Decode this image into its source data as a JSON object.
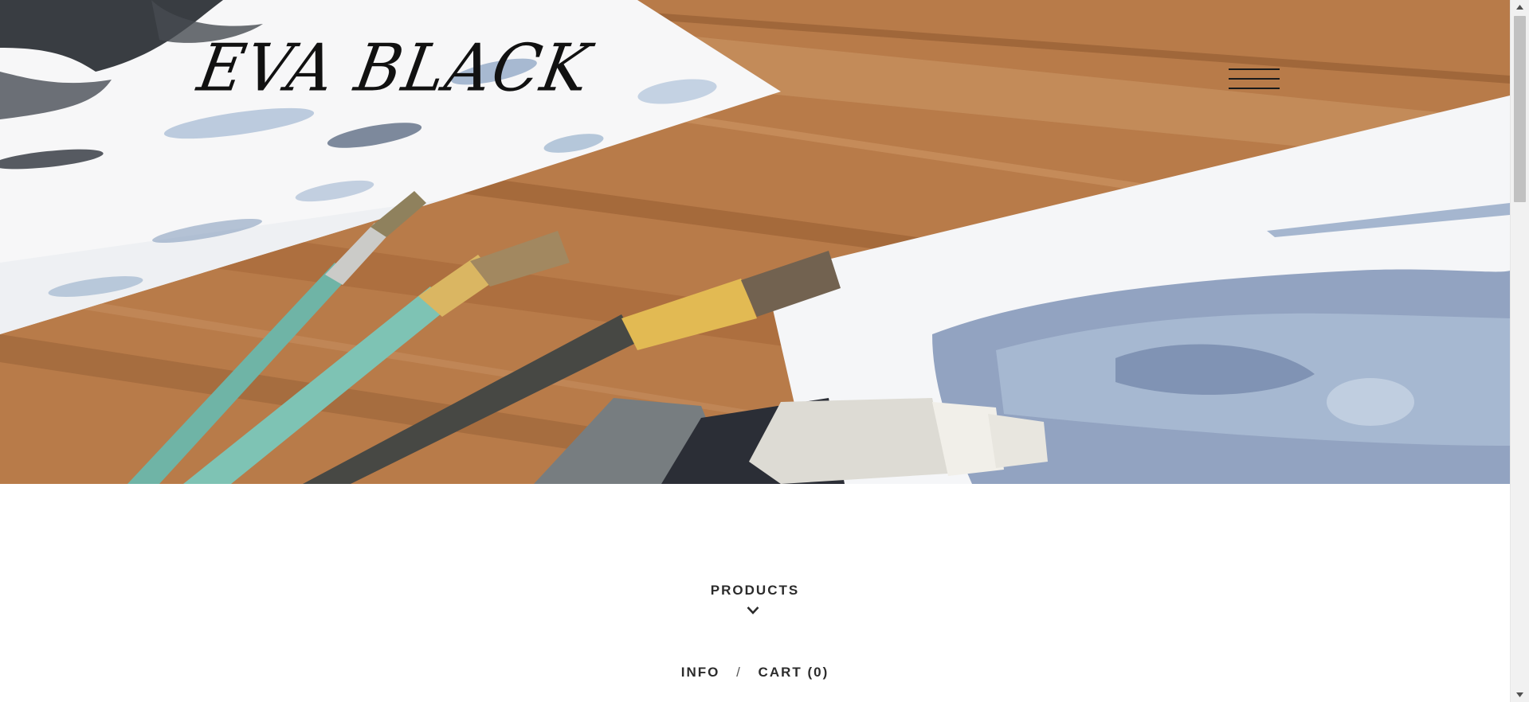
{
  "site": {
    "logo_text": "EVA BLACK"
  },
  "header": {
    "menu_icon": "hamburger-menu-icon"
  },
  "main": {
    "products_label": "PRODUCTS",
    "products_icon": "chevron-down-icon",
    "links": {
      "info_label": "INFO",
      "separator": "/",
      "cart_label": "CART (0)"
    }
  },
  "scrollbar": {
    "up_icon": "scroll-up-arrow-icon",
    "down_icon": "scroll-down-arrow-icon"
  },
  "colors": {
    "text_dark": "#2b2b2b",
    "logo": "#111111",
    "wood": "#b8743d",
    "paint_blue": "#8fa6c4",
    "brush_teal": "#6fb8a8",
    "scrollbar_track": "#f1f1f1",
    "scrollbar_thumb": "#c1c1c1"
  }
}
